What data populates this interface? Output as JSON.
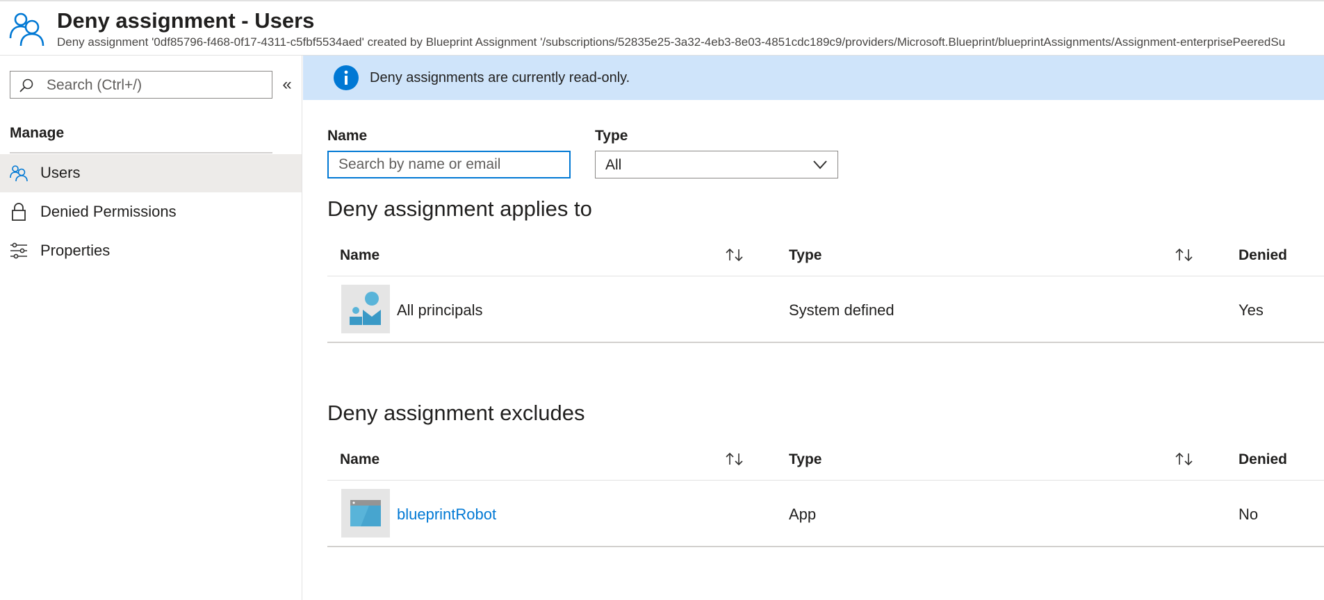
{
  "header": {
    "title": "Deny assignment - Users",
    "subtitle": "Deny assignment '0df85796-f468-0f17-4311-c5fbf5534aed' created by Blueprint Assignment '/subscriptions/52835e25-3a32-4eb3-8e03-4851cdc189c9/providers/Microsoft.Blueprint/blueprintAssignments/Assignment-enterprisePeeredSu",
    "icon": "users-icon"
  },
  "sidebar": {
    "search_placeholder": "Search (Ctrl+/)",
    "collapse_label": "«",
    "section_label": "Manage",
    "items": [
      {
        "label": "Users",
        "icon": "users-icon",
        "active": true
      },
      {
        "label": "Denied Permissions",
        "icon": "lock-icon",
        "active": false
      },
      {
        "label": "Properties",
        "icon": "sliders-icon",
        "active": false
      }
    ]
  },
  "banner": {
    "text": "Deny assignments are currently read-only.",
    "icon": "info-icon"
  },
  "filters": {
    "name_label": "Name",
    "name_placeholder": "Search by name or email",
    "type_label": "Type",
    "type_value": "All"
  },
  "applies_to": {
    "heading": "Deny assignment applies to",
    "columns": {
      "name": "Name",
      "type": "Type",
      "denied": "Denied"
    },
    "rows": [
      {
        "name": "All principals",
        "type": "System defined",
        "denied": "Yes",
        "icon": "principals-icon"
      }
    ]
  },
  "excludes": {
    "heading": "Deny assignment excludes",
    "columns": {
      "name": "Name",
      "type": "Type",
      "denied": "Denied"
    },
    "rows": [
      {
        "name": "blueprintRobot",
        "type": "App",
        "denied": "No",
        "icon": "app-icon"
      }
    ]
  },
  "colors": {
    "accent": "#0078d4",
    "banner_bg": "#cfe4fa",
    "active_nav_bg": "#edebe9"
  }
}
